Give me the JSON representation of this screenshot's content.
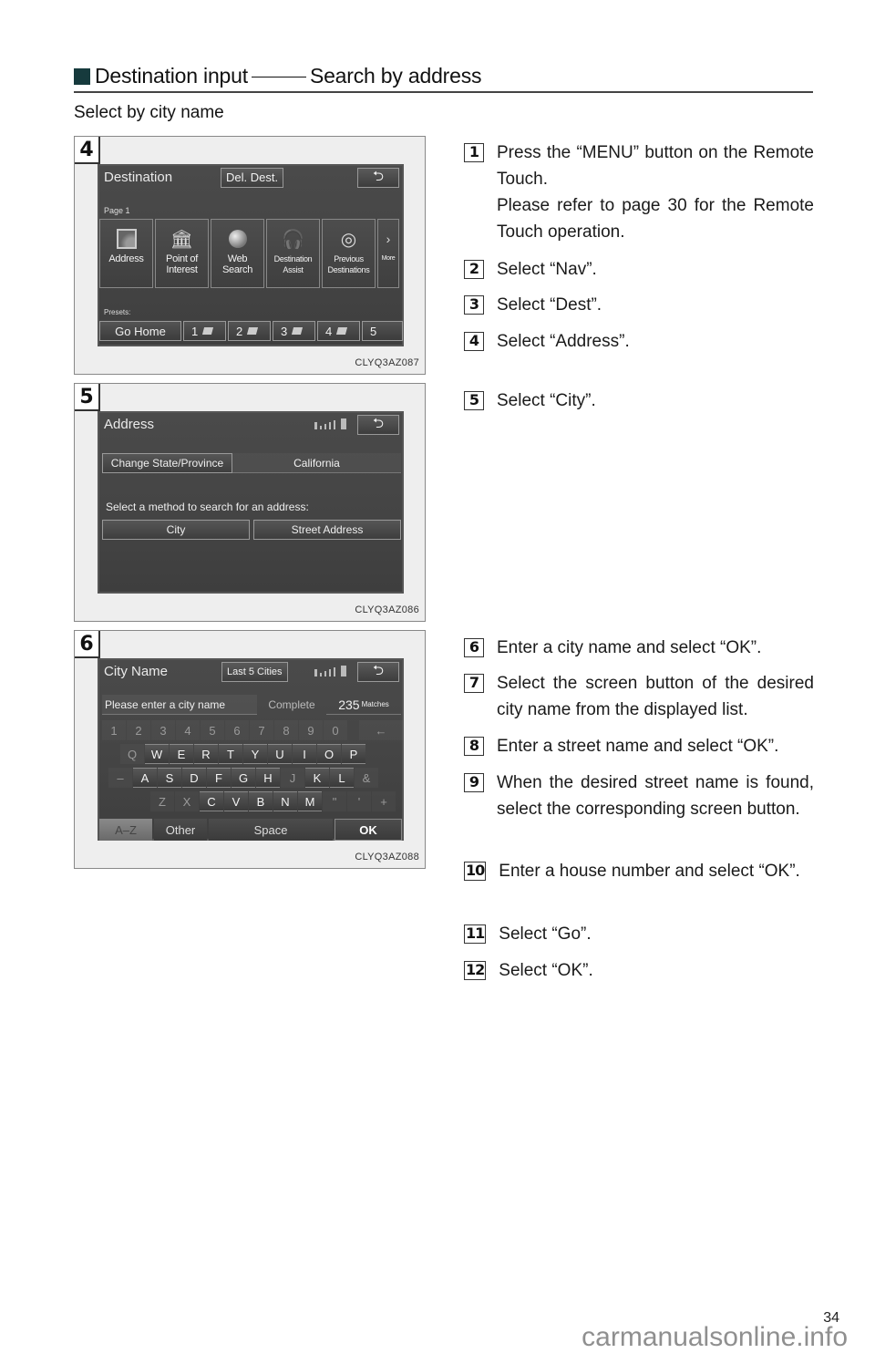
{
  "header": {
    "section_title": "Destination input",
    "section_subtitle": "Search by address",
    "subheading": "Select by city name"
  },
  "figures": [
    {
      "step_badge": "4",
      "code": "CLYQ3AZ087",
      "screen": {
        "title": "Destination",
        "header_button": "Del. Dest.",
        "page_label": "Page 1",
        "tiles": [
          {
            "icon": "address-icon",
            "label_line1": "Address",
            "label_line2": ""
          },
          {
            "icon": "point-of-interest-icon",
            "label_line1": "Point of",
            "label_line2": "Interest"
          },
          {
            "icon": "web-search-icon",
            "label_line1": "Web",
            "label_line2": "Search"
          },
          {
            "icon": "destination-assist-icon",
            "label_line1": "Destination",
            "label_line2": "Assist"
          },
          {
            "icon": "previous-destinations-icon",
            "label_line1": "Previous",
            "label_line2": "Destinations"
          },
          {
            "icon": "chevron-right-icon",
            "label_line1": "More",
            "label_line2": ""
          }
        ],
        "presets_label": "Presets:",
        "presets": [
          "Go Home",
          "1",
          "2",
          "3",
          "4",
          "5"
        ]
      }
    },
    {
      "step_badge": "5",
      "code": "CLYQ3AZ086",
      "screen": {
        "title": "Address",
        "change_state_button": "Change State/Province",
        "state_value": "California",
        "prompt": "Select a method to search for an address:",
        "city_button": "City",
        "street_button": "Street Address"
      }
    },
    {
      "step_badge": "6",
      "code": "CLYQ3AZ088",
      "screen": {
        "title": "City Name",
        "header_button": "Last 5 Cities",
        "input_placeholder": "Please enter a city name",
        "complete_label": "Complete",
        "matches_count": "235",
        "matches_label": "Matches",
        "number_row": [
          "1",
          "2",
          "3",
          "4",
          "5",
          "6",
          "7",
          "8",
          "9",
          "0"
        ],
        "backspace": "←",
        "row_q": [
          {
            "k": "Q",
            "on": false
          },
          {
            "k": "W",
            "on": true
          },
          {
            "k": "E",
            "on": true
          },
          {
            "k": "R",
            "on": true
          },
          {
            "k": "T",
            "on": true
          },
          {
            "k": "Y",
            "on": true
          },
          {
            "k": "U",
            "on": true
          },
          {
            "k": "I",
            "on": true
          },
          {
            "k": "O",
            "on": true
          },
          {
            "k": "P",
            "on": true
          }
        ],
        "row_a": [
          {
            "k": "–",
            "on": false
          },
          {
            "k": "A",
            "on": true
          },
          {
            "k": "S",
            "on": true
          },
          {
            "k": "D",
            "on": true
          },
          {
            "k": "F",
            "on": true
          },
          {
            "k": "G",
            "on": true
          },
          {
            "k": "H",
            "on": true
          },
          {
            "k": "J",
            "on": false
          },
          {
            "k": "K",
            "on": true
          },
          {
            "k": "L",
            "on": true
          },
          {
            "k": "&",
            "on": false
          }
        ],
        "row_z": [
          {
            "k": "Z",
            "on": false
          },
          {
            "k": "X",
            "on": false
          },
          {
            "k": "C",
            "on": true
          },
          {
            "k": "V",
            "on": true
          },
          {
            "k": "B",
            "on": true
          },
          {
            "k": "N",
            "on": true
          },
          {
            "k": "M",
            "on": true
          },
          {
            "k": "\"",
            "on": false
          },
          {
            "k": "'",
            "on": false
          },
          {
            "k": "+",
            "on": false
          }
        ],
        "az_button": "A–Z",
        "other_button": "Other",
        "space_button": "Space",
        "ok_button": "OK"
      }
    }
  ],
  "steps": [
    {
      "num": "1",
      "lines": [
        "Press the “MENU” button on the Remote Touch.",
        "Please refer to page 30 for the Remote Touch operation."
      ]
    },
    {
      "num": "2",
      "lines": [
        "Select “Nav”."
      ]
    },
    {
      "num": "3",
      "lines": [
        "Select “Dest”."
      ]
    },
    {
      "num": "4",
      "lines": [
        "Select “Address”."
      ]
    },
    {
      "num": "5",
      "lines": [
        "Select “City”."
      ]
    },
    {
      "num": "6",
      "lines": [
        "Enter a city name and select “OK”."
      ]
    },
    {
      "num": "7",
      "lines": [
        "Select the screen button of the desired city name from the displayed list."
      ]
    },
    {
      "num": "8",
      "lines": [
        "Enter a street name and select “OK”."
      ]
    },
    {
      "num": "9",
      "lines": [
        "When the desired street name is found, select the corresponding screen button."
      ]
    },
    {
      "num": "10",
      "lines": [
        "Enter a house number and select “OK”."
      ]
    },
    {
      "num": "11",
      "lines": [
        "Select “Go”."
      ]
    },
    {
      "num": "12",
      "lines": [
        "Select “OK”."
      ]
    }
  ],
  "page_number": "34",
  "watermark": "carmanualsonline.info"
}
